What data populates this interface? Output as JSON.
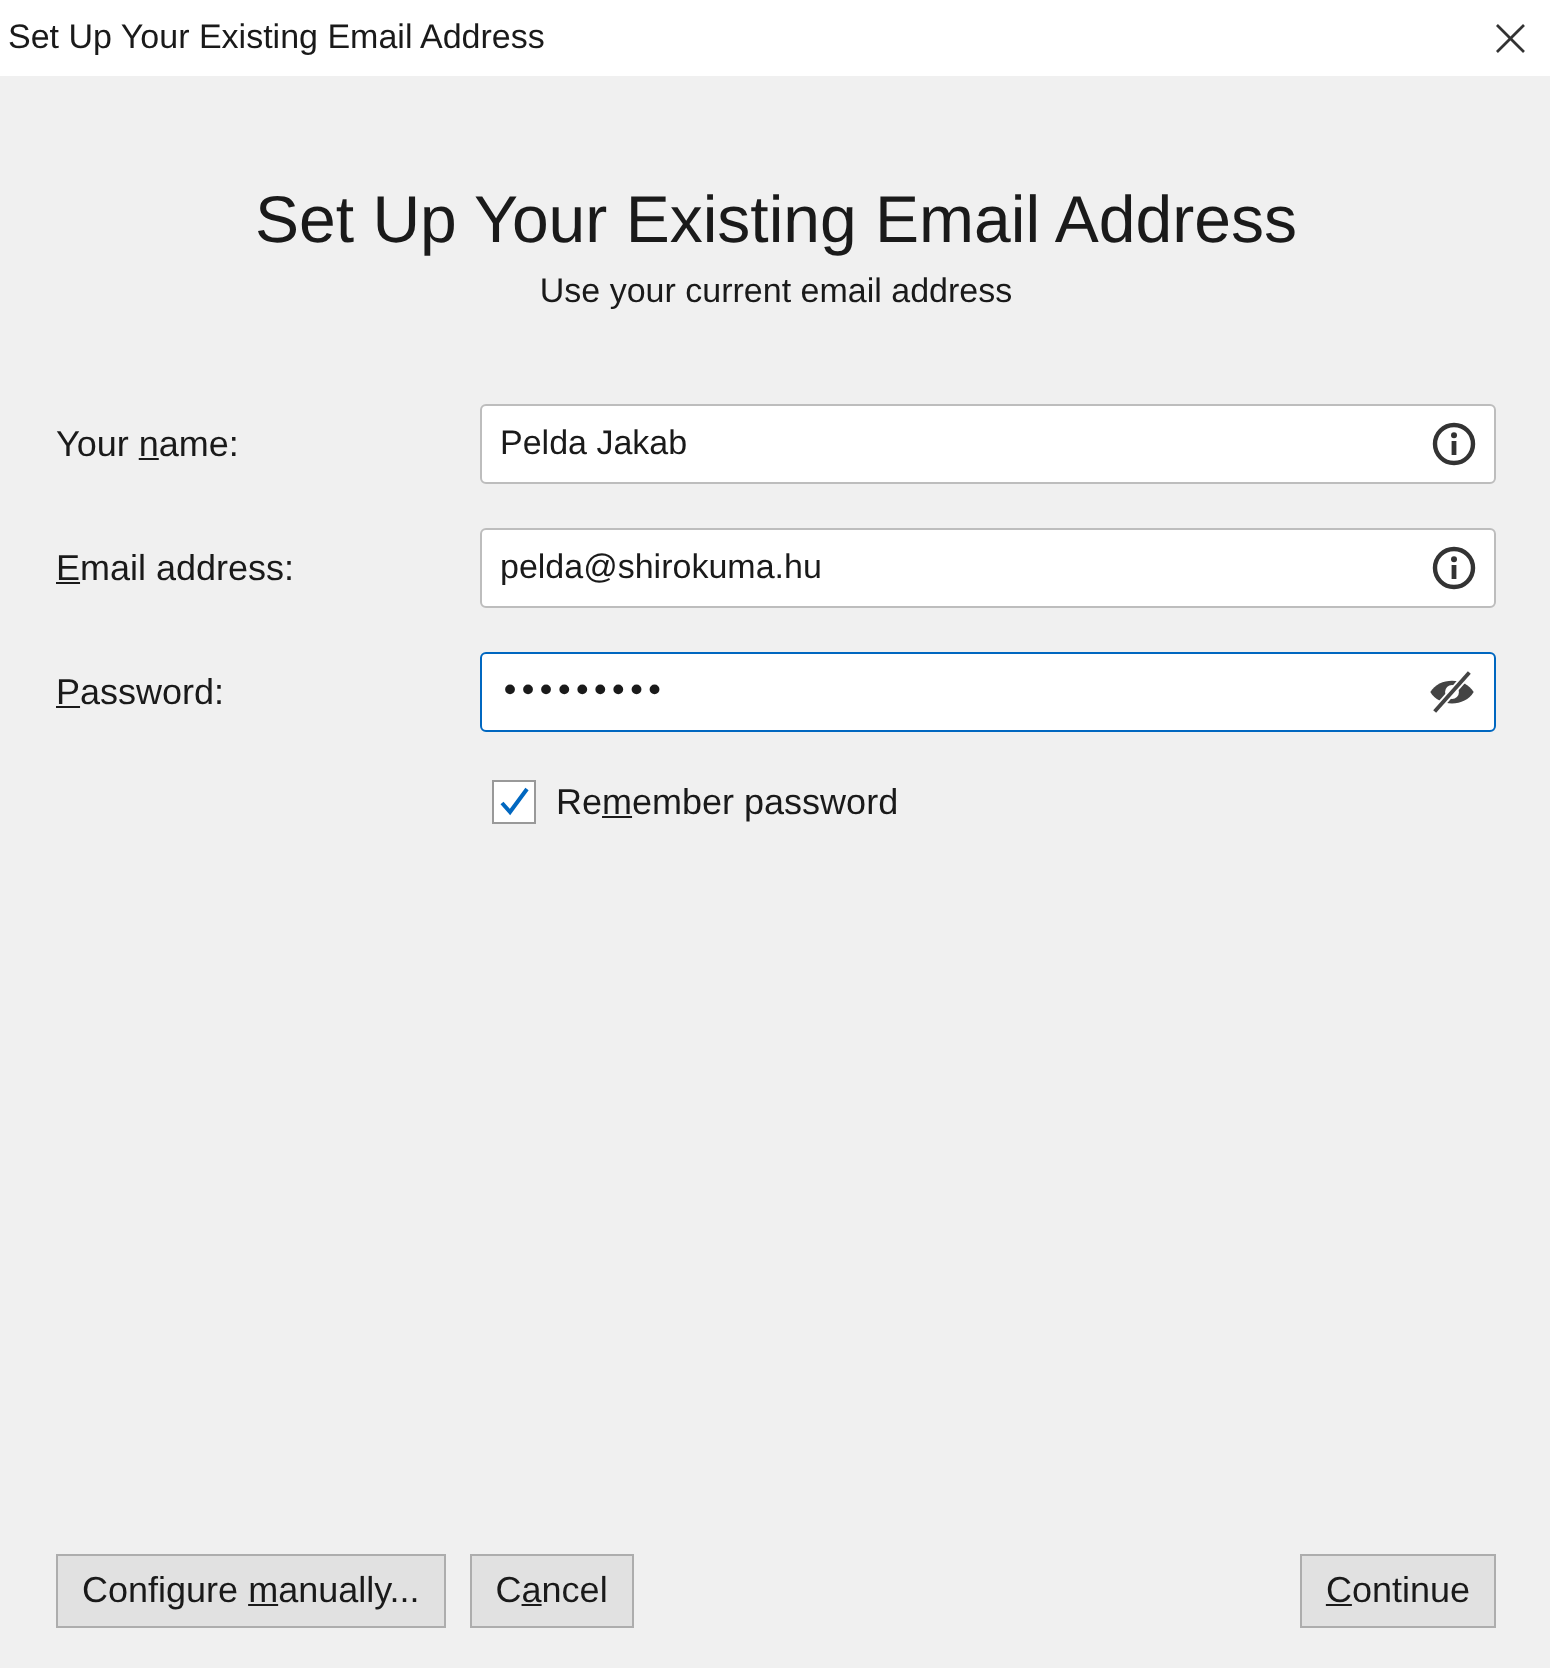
{
  "window": {
    "title": "Set Up Your Existing Email Address",
    "close": "×"
  },
  "heading": "Set Up Your Existing Email Address",
  "subtitle": "Use your current email address",
  "fields": [
    {
      "label": {
        "before": "Your ",
        "key": "n",
        "after": "ame:"
      },
      "value": "Pelda Jakab",
      "kind": "info",
      "focused": false
    },
    {
      "label": {
        "key": "E",
        "after": "mail address:"
      },
      "value": "pelda@shirokuma.hu",
      "kind": "info",
      "focused": false
    },
    {
      "label": {
        "key": "P",
        "after": "assword:"
      },
      "value": "•••••••••",
      "kind": "password",
      "focused": true
    }
  ],
  "remember": {
    "label": {
      "before": "Re",
      "key": "m",
      "after": "ember password"
    },
    "checked": true
  },
  "left_buttons": [
    {
      "label": {
        "before": "Configure ",
        "key": "m",
        "after": "anually..."
      }
    },
    {
      "label": {
        "before": "C",
        "key": "a",
        "after": "ncel"
      }
    }
  ],
  "right_buttons": [
    {
      "label": {
        "key": "C",
        "after": "ontinue"
      }
    }
  ]
}
